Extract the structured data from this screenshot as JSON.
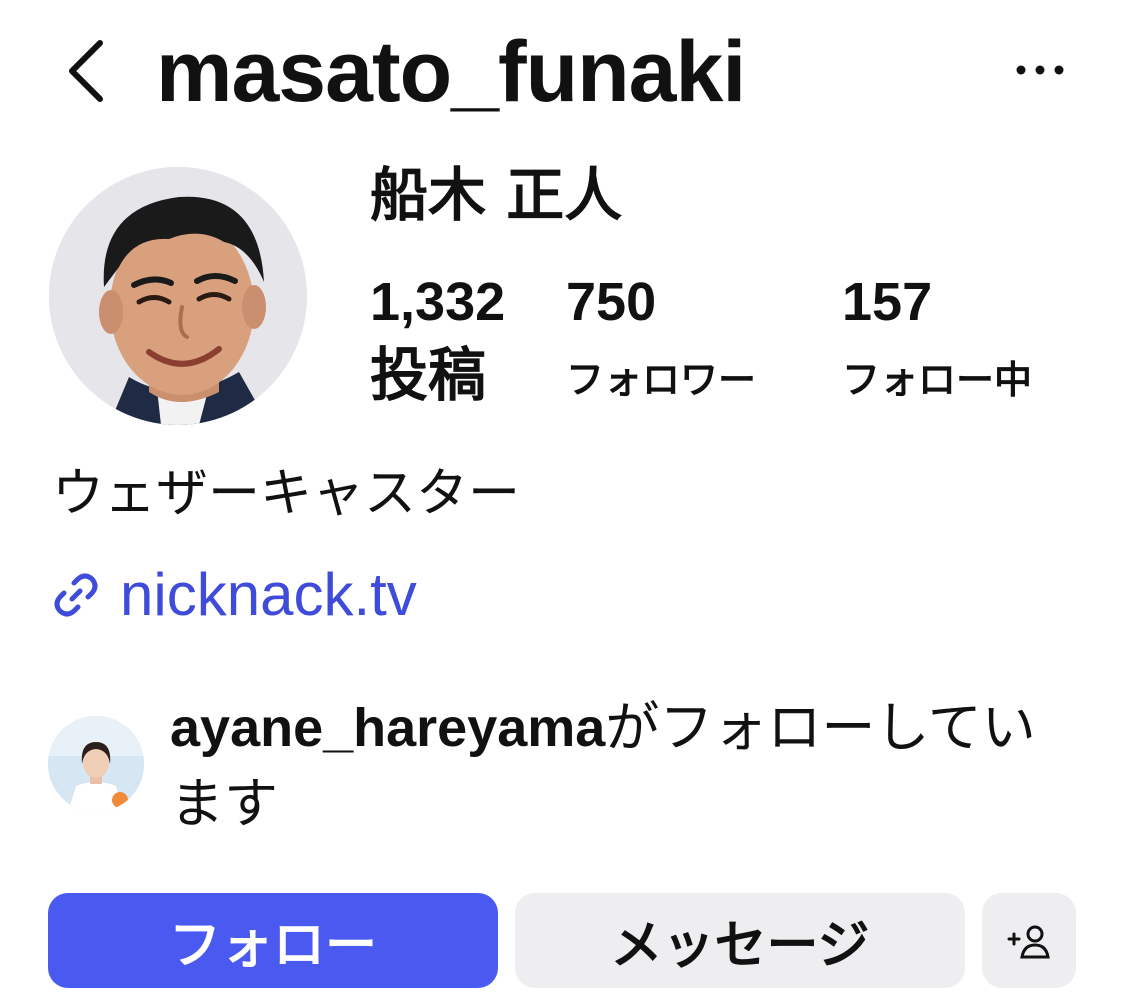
{
  "header": {
    "username": "masato_funaki",
    "back_icon": "chevron-left-icon",
    "more_icon": "more-horizontal-icon"
  },
  "profile": {
    "display_name": "船木 正人",
    "avatar_icon": "profile-photo"
  },
  "stats": {
    "posts": {
      "count": "1,332",
      "label": "投稿"
    },
    "followers": {
      "count": "750",
      "label": "フォロワー"
    },
    "following": {
      "count": "157",
      "label": "フォロー中"
    }
  },
  "bio": {
    "text": "ウェザーキャスター",
    "link_text": "nicknack.tv",
    "link_color": "#3f4cd9"
  },
  "followed_by": {
    "username": "ayane_hareyama",
    "suffix": "がフォローしています"
  },
  "actions": {
    "follow_label": "フォロー",
    "message_label": "メッセージ",
    "follow_color": "#4a5af0",
    "secondary_color": "#eeeef1"
  }
}
